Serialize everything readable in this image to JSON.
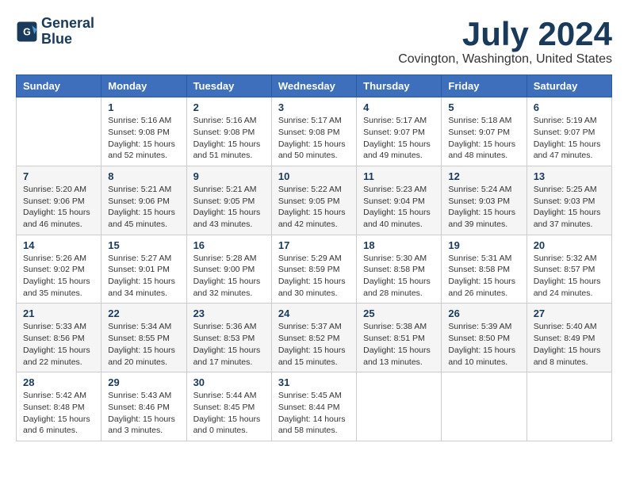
{
  "header": {
    "logo_line1": "General",
    "logo_line2": "Blue",
    "title": "July 2024",
    "subtitle": "Covington, Washington, United States"
  },
  "weekdays": [
    "Sunday",
    "Monday",
    "Tuesday",
    "Wednesday",
    "Thursday",
    "Friday",
    "Saturday"
  ],
  "weeks": [
    [
      {
        "day": "",
        "info": ""
      },
      {
        "day": "1",
        "info": "Sunrise: 5:16 AM\nSunset: 9:08 PM\nDaylight: 15 hours\nand 52 minutes."
      },
      {
        "day": "2",
        "info": "Sunrise: 5:16 AM\nSunset: 9:08 PM\nDaylight: 15 hours\nand 51 minutes."
      },
      {
        "day": "3",
        "info": "Sunrise: 5:17 AM\nSunset: 9:08 PM\nDaylight: 15 hours\nand 50 minutes."
      },
      {
        "day": "4",
        "info": "Sunrise: 5:17 AM\nSunset: 9:07 PM\nDaylight: 15 hours\nand 49 minutes."
      },
      {
        "day": "5",
        "info": "Sunrise: 5:18 AM\nSunset: 9:07 PM\nDaylight: 15 hours\nand 48 minutes."
      },
      {
        "day": "6",
        "info": "Sunrise: 5:19 AM\nSunset: 9:07 PM\nDaylight: 15 hours\nand 47 minutes."
      }
    ],
    [
      {
        "day": "7",
        "info": "Sunrise: 5:20 AM\nSunset: 9:06 PM\nDaylight: 15 hours\nand 46 minutes."
      },
      {
        "day": "8",
        "info": "Sunrise: 5:21 AM\nSunset: 9:06 PM\nDaylight: 15 hours\nand 45 minutes."
      },
      {
        "day": "9",
        "info": "Sunrise: 5:21 AM\nSunset: 9:05 PM\nDaylight: 15 hours\nand 43 minutes."
      },
      {
        "day": "10",
        "info": "Sunrise: 5:22 AM\nSunset: 9:05 PM\nDaylight: 15 hours\nand 42 minutes."
      },
      {
        "day": "11",
        "info": "Sunrise: 5:23 AM\nSunset: 9:04 PM\nDaylight: 15 hours\nand 40 minutes."
      },
      {
        "day": "12",
        "info": "Sunrise: 5:24 AM\nSunset: 9:03 PM\nDaylight: 15 hours\nand 39 minutes."
      },
      {
        "day": "13",
        "info": "Sunrise: 5:25 AM\nSunset: 9:03 PM\nDaylight: 15 hours\nand 37 minutes."
      }
    ],
    [
      {
        "day": "14",
        "info": "Sunrise: 5:26 AM\nSunset: 9:02 PM\nDaylight: 15 hours\nand 35 minutes."
      },
      {
        "day": "15",
        "info": "Sunrise: 5:27 AM\nSunset: 9:01 PM\nDaylight: 15 hours\nand 34 minutes."
      },
      {
        "day": "16",
        "info": "Sunrise: 5:28 AM\nSunset: 9:00 PM\nDaylight: 15 hours\nand 32 minutes."
      },
      {
        "day": "17",
        "info": "Sunrise: 5:29 AM\nSunset: 8:59 PM\nDaylight: 15 hours\nand 30 minutes."
      },
      {
        "day": "18",
        "info": "Sunrise: 5:30 AM\nSunset: 8:58 PM\nDaylight: 15 hours\nand 28 minutes."
      },
      {
        "day": "19",
        "info": "Sunrise: 5:31 AM\nSunset: 8:58 PM\nDaylight: 15 hours\nand 26 minutes."
      },
      {
        "day": "20",
        "info": "Sunrise: 5:32 AM\nSunset: 8:57 PM\nDaylight: 15 hours\nand 24 minutes."
      }
    ],
    [
      {
        "day": "21",
        "info": "Sunrise: 5:33 AM\nSunset: 8:56 PM\nDaylight: 15 hours\nand 22 minutes."
      },
      {
        "day": "22",
        "info": "Sunrise: 5:34 AM\nSunset: 8:55 PM\nDaylight: 15 hours\nand 20 minutes."
      },
      {
        "day": "23",
        "info": "Sunrise: 5:36 AM\nSunset: 8:53 PM\nDaylight: 15 hours\nand 17 minutes."
      },
      {
        "day": "24",
        "info": "Sunrise: 5:37 AM\nSunset: 8:52 PM\nDaylight: 15 hours\nand 15 minutes."
      },
      {
        "day": "25",
        "info": "Sunrise: 5:38 AM\nSunset: 8:51 PM\nDaylight: 15 hours\nand 13 minutes."
      },
      {
        "day": "26",
        "info": "Sunrise: 5:39 AM\nSunset: 8:50 PM\nDaylight: 15 hours\nand 10 minutes."
      },
      {
        "day": "27",
        "info": "Sunrise: 5:40 AM\nSunset: 8:49 PM\nDaylight: 15 hours\nand 8 minutes."
      }
    ],
    [
      {
        "day": "28",
        "info": "Sunrise: 5:42 AM\nSunset: 8:48 PM\nDaylight: 15 hours\nand 6 minutes."
      },
      {
        "day": "29",
        "info": "Sunrise: 5:43 AM\nSunset: 8:46 PM\nDaylight: 15 hours\nand 3 minutes."
      },
      {
        "day": "30",
        "info": "Sunrise: 5:44 AM\nSunset: 8:45 PM\nDaylight: 15 hours\nand 0 minutes."
      },
      {
        "day": "31",
        "info": "Sunrise: 5:45 AM\nSunset: 8:44 PM\nDaylight: 14 hours\nand 58 minutes."
      },
      {
        "day": "",
        "info": ""
      },
      {
        "day": "",
        "info": ""
      },
      {
        "day": "",
        "info": ""
      }
    ]
  ]
}
